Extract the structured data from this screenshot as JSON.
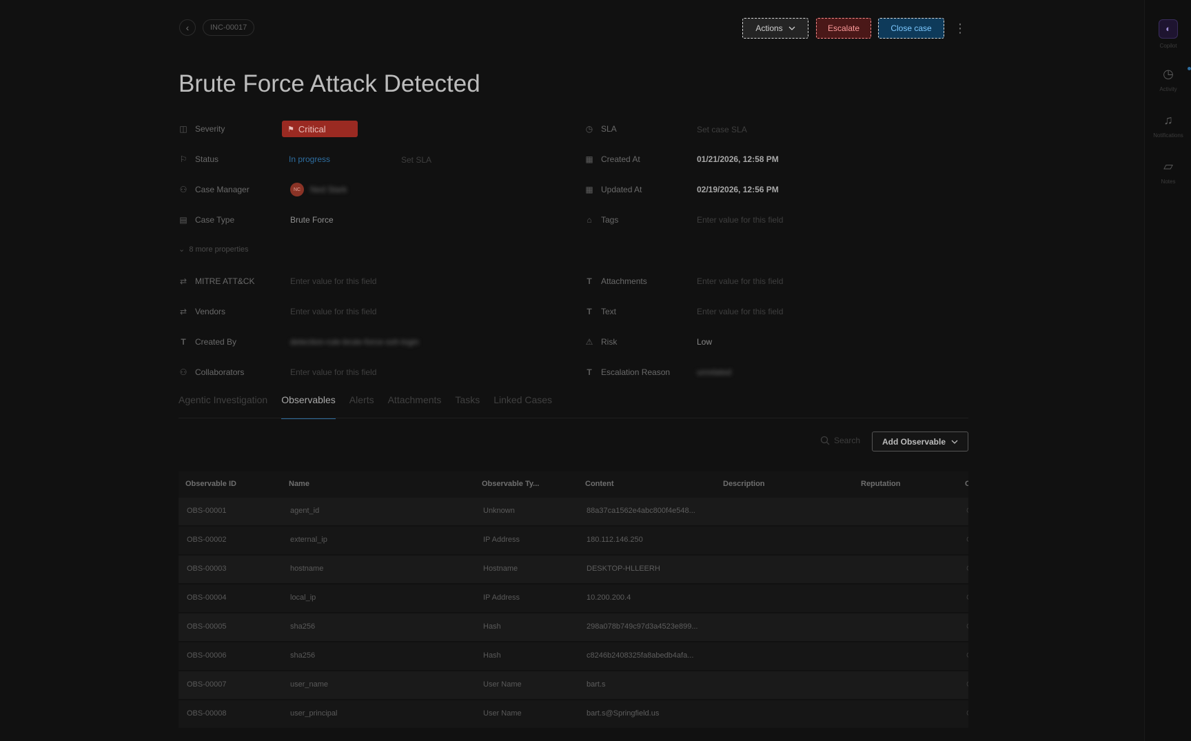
{
  "header": {
    "case_id": "INC-00017",
    "actions_label": "Actions",
    "escalate_label": "Escalate",
    "close_label": "Close case"
  },
  "title": "Brute Force Attack Detected",
  "properties_left": {
    "severity": {
      "label": "Severity",
      "value": "Critical"
    },
    "status": {
      "label": "Status",
      "value": "In progress",
      "sla_action": "Set SLA"
    },
    "case_manager": {
      "label": "Case Manager",
      "avatar_initials": "NC",
      "value": "Ned Stark"
    },
    "case_type": {
      "label": "Case Type",
      "value": "Brute Force"
    },
    "more_properties": "8 more properties",
    "mitre": {
      "label": "MITRE ATT&CK",
      "value": "Enter value for this field"
    },
    "vendors": {
      "label": "Vendors",
      "value": "Enter value for this field"
    },
    "created_by": {
      "label": "Created By",
      "value": "detection-rule-brute-force-ssh-login"
    },
    "collaborators": {
      "label": "Collaborators",
      "value": "Enter value for this field"
    }
  },
  "properties_right": {
    "sla": {
      "label": "SLA",
      "value": "Set case SLA"
    },
    "created_at": {
      "label": "Created At",
      "value": "01/21/2026, 12:58 PM"
    },
    "updated_at": {
      "label": "Updated At",
      "value": "02/19/2026, 12:56 PM"
    },
    "tags": {
      "label": "Tags",
      "value": "Enter value for this field"
    },
    "attachments": {
      "label": "Attachments",
      "value": "Enter value for this field"
    },
    "text": {
      "label": "Text",
      "value": "Enter value for this field"
    },
    "risk": {
      "label": "Risk",
      "value": "Low"
    },
    "escalation_reason": {
      "label": "Escalation Reason",
      "value": "unrelated"
    }
  },
  "tabs": [
    {
      "label": "Agentic Investigation"
    },
    {
      "label": "Observables"
    },
    {
      "label": "Alerts"
    },
    {
      "label": "Attachments"
    },
    {
      "label": "Tasks"
    },
    {
      "label": "Linked Cases"
    }
  ],
  "toolbar": {
    "search_placeholder": "Search",
    "add_label": "Add Observable"
  },
  "table": {
    "columns": [
      "Observable ID",
      "Name",
      "Observable Ty...",
      "Content",
      "Description",
      "Reputation",
      "C"
    ],
    "rows": [
      {
        "id": "OBS-00001",
        "name": "agent_id",
        "type": "Unknown",
        "content": "88a37ca1562e4abc800f4e548...",
        "edge": "C"
      },
      {
        "id": "OBS-00002",
        "name": "external_ip",
        "type": "IP Address",
        "content": "180.112.146.250",
        "edge": "C"
      },
      {
        "id": "OBS-00003",
        "name": "hostname",
        "type": "Hostname",
        "content": "DESKTOP-HLLEERH",
        "edge": "C"
      },
      {
        "id": "OBS-00004",
        "name": "local_ip",
        "type": "IP Address",
        "content": "10.200.200.4",
        "edge": "C"
      },
      {
        "id": "OBS-00005",
        "name": "sha256",
        "type": "Hash",
        "content": "298a078b749c97d3a4523e899...",
        "edge": "C"
      },
      {
        "id": "OBS-00006",
        "name": "sha256",
        "type": "Hash",
        "content": "c8246b2408325fa8abedb4afa...",
        "edge": "C"
      },
      {
        "id": "OBS-00007",
        "name": "user_name",
        "type": "User Name",
        "content": "bart.s",
        "edge": "C"
      },
      {
        "id": "OBS-00008",
        "name": "user_principal",
        "type": "User Name",
        "content": "bart.s@Springfield.us",
        "edge": "C"
      }
    ]
  },
  "rail": {
    "copilot": "Copilot",
    "activity": "Activity",
    "notifications": "Notifications",
    "notes": "Notes"
  },
  "colors": {
    "background": "#111111",
    "critical": "#9a2a22",
    "accent_blue": "#2e6ea0"
  }
}
